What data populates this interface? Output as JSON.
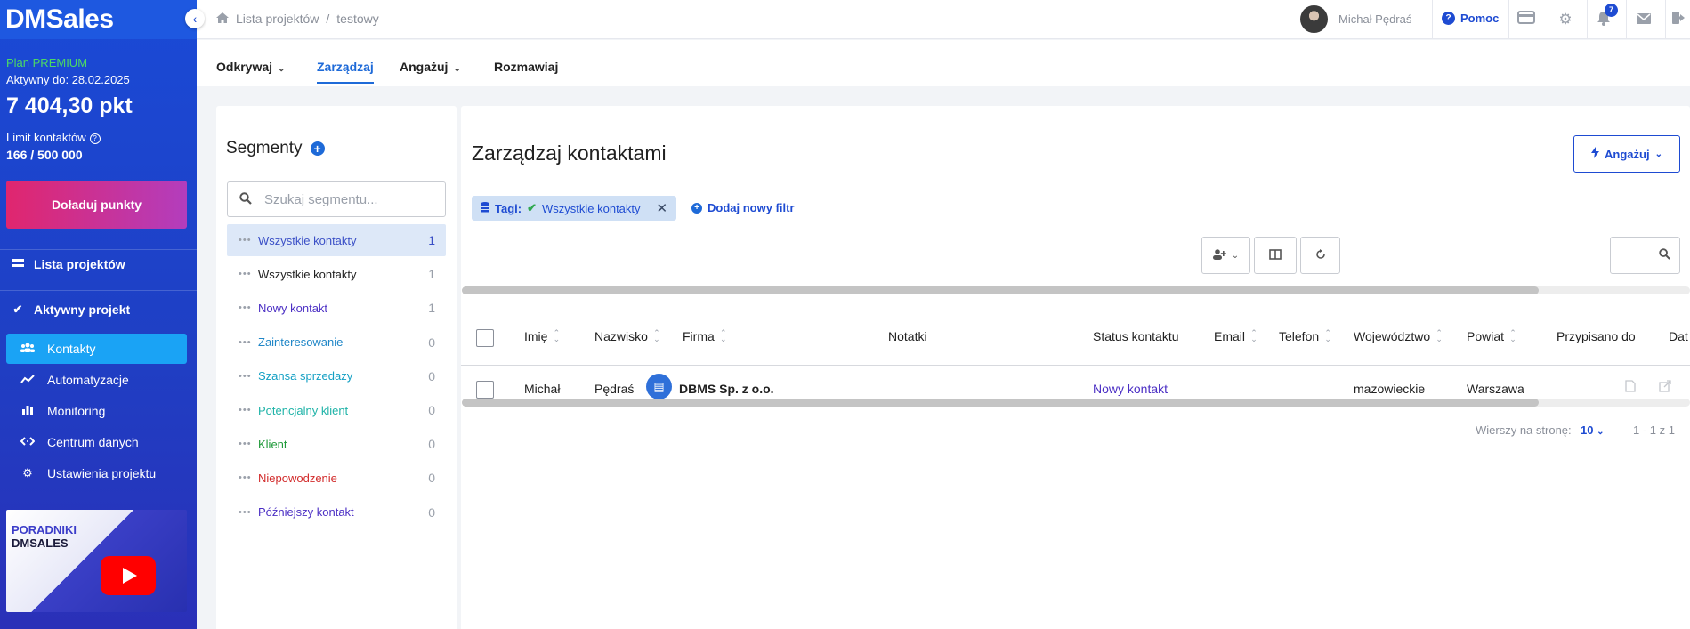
{
  "app": {
    "logo": "DMSales",
    "collapse_icon": "‹"
  },
  "sidebar": {
    "plan": "Plan PREMIUM",
    "active_until": "Aktywny do: 28.02.2025",
    "points": "7 404,30 pkt",
    "limit_label": "Limit kontaktów",
    "limit_value": "166 / 500 000",
    "topup_label": "Doładuj punkty",
    "projects_label": "Lista projektów",
    "active_project_label": "Aktywny projekt",
    "items": [
      {
        "label": "Kontakty",
        "icon": "contacts-icon",
        "active": true
      },
      {
        "label": "Automatyzacje",
        "icon": "automation-icon",
        "active": false
      },
      {
        "label": "Monitoring",
        "icon": "monitoring-icon",
        "active": false
      },
      {
        "label": "Centrum danych",
        "icon": "data-center-icon",
        "active": false
      },
      {
        "label": "Ustawienia projektu",
        "icon": "gear-icon",
        "active": false
      }
    ],
    "tutorial_line1": "PORADNIKI",
    "tutorial_line2": "DMSALES"
  },
  "topbar": {
    "breadcrumb_root": "Lista projektów",
    "breadcrumb_sep": "/",
    "breadcrumb_current": "testowy",
    "user_name": "Michał Pędraś",
    "help_label": "Pomoc",
    "notifications_count": "7"
  },
  "tabs": [
    {
      "label": "Odkrywaj",
      "has_caret": true,
      "active": false
    },
    {
      "label": "Zarządzaj",
      "has_caret": false,
      "active": true
    },
    {
      "label": "Angażuj",
      "has_caret": true,
      "active": false
    },
    {
      "label": "Rozmawiaj",
      "has_caret": false,
      "active": false
    }
  ],
  "segments": {
    "title": "Segmenty",
    "search_placeholder": "Szukaj segmentu...",
    "items": [
      {
        "label": "Wszystkie kontakty",
        "count": "1",
        "color": "#3a4fc6",
        "active": true
      },
      {
        "label": "Wszystkie kontakty",
        "count": "1",
        "color": "#212121",
        "active": false
      },
      {
        "label": "Nowy kontakt",
        "count": "1",
        "color": "#4b2fc4",
        "active": false
      },
      {
        "label": "Zainteresowanie",
        "count": "0",
        "color": "#1f86c7",
        "active": false
      },
      {
        "label": "Szansa sprzedaży",
        "count": "0",
        "color": "#14a0c4",
        "active": false
      },
      {
        "label": "Potencjalny klient",
        "count": "0",
        "color": "#1fb3a8",
        "active": false
      },
      {
        "label": "Klient",
        "count": "0",
        "color": "#1f9a3a",
        "active": false
      },
      {
        "label": "Niepowodzenie",
        "count": "0",
        "color": "#d22b2b",
        "active": false
      },
      {
        "label": "Późniejszy kontakt",
        "count": "0",
        "color": "#4b2fc4",
        "active": false
      }
    ]
  },
  "main": {
    "title": "Zarządzaj kontaktami",
    "engage_label": "Angażuj",
    "filter_prefix": "Tagi:",
    "filter_value": "Wszystkie kontakty",
    "add_filter_label": "Dodaj nowy filtr",
    "columns": [
      "Imię",
      "Nazwisko",
      "Firma",
      "Notatki",
      "Status kontaktu",
      "Email",
      "Telefon",
      "Województwo",
      "Powiat",
      "Przypisano do",
      "Dat"
    ],
    "rows": [
      {
        "first_name": "Michał",
        "last_name": "Pędraś",
        "company": "DBMS Sp. z o.o.",
        "notes": "",
        "status": "Nowy kontakt",
        "email": "",
        "phone": "",
        "voivodeship": "mazowieckie",
        "county": "Warszawa",
        "assigned_to": ""
      }
    ],
    "rows_per_page_label": "Wierszy na stronę:",
    "rows_per_page_value": "10",
    "range_label": "1 - 1 z 1"
  },
  "colors": {
    "accent": "#1e4bd2",
    "sidebar_active": "#1aa3f5",
    "status_new": "#4b2fc4"
  }
}
